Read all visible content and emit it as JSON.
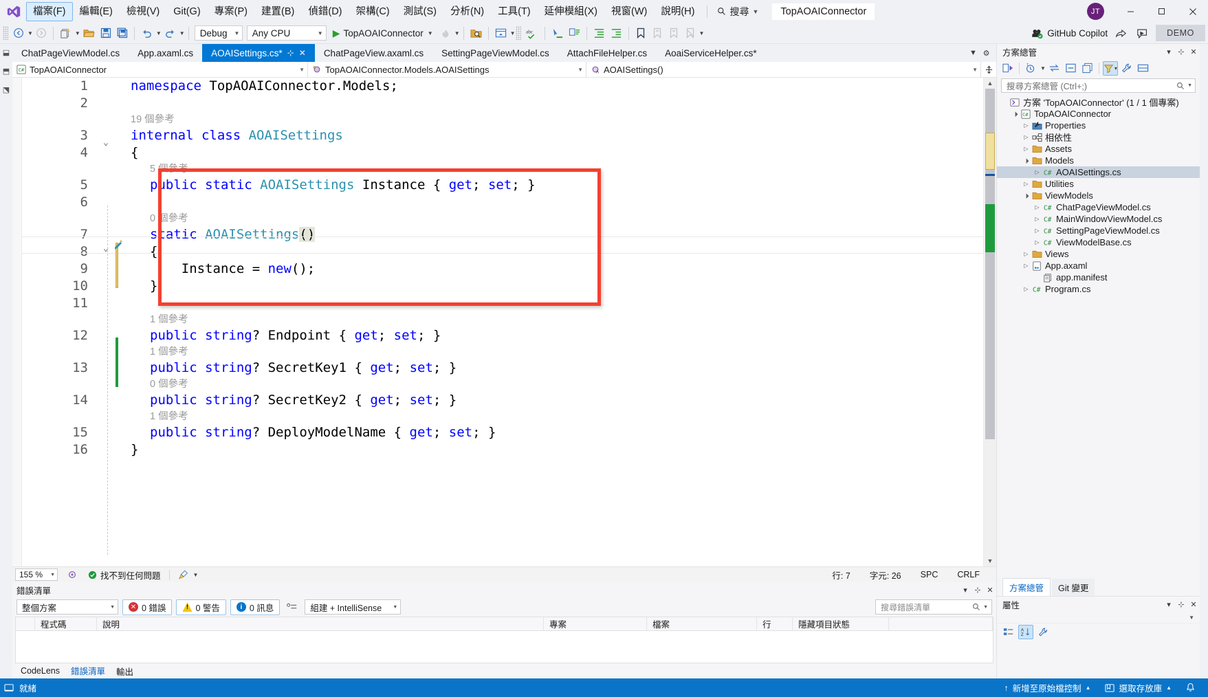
{
  "window": {
    "title": "TopAOAIConnector",
    "avatar_initials": "JT",
    "minimize": "–",
    "maximize": "▢",
    "close": "✕"
  },
  "menu": {
    "items": [
      {
        "label": "檔案(F)",
        "name": "file"
      },
      {
        "label": "編輯(E)",
        "name": "edit"
      },
      {
        "label": "檢視(V)",
        "name": "view"
      },
      {
        "label": "Git(G)",
        "name": "git"
      },
      {
        "label": "專案(P)",
        "name": "project"
      },
      {
        "label": "建置(B)",
        "name": "build"
      },
      {
        "label": "偵錯(D)",
        "name": "debug"
      },
      {
        "label": "架構(C)",
        "name": "architecture"
      },
      {
        "label": "測試(S)",
        "name": "test"
      },
      {
        "label": "分析(N)",
        "name": "analyze"
      },
      {
        "label": "工具(T)",
        "name": "tools"
      },
      {
        "label": "延伸模組(X)",
        "name": "extensions"
      },
      {
        "label": "視窗(W)",
        "name": "window"
      },
      {
        "label": "說明(H)",
        "name": "help"
      }
    ],
    "active_index": 0,
    "search_label": "搜尋"
  },
  "toolbar": {
    "configuration": "Debug",
    "platform": "Any CPU",
    "run_target": "TopAOAIConnector",
    "copilot_label": "GitHub Copilot",
    "demo_label": "DEMO"
  },
  "tabs": {
    "items": [
      {
        "label": "ChatPageViewModel.cs",
        "active": false
      },
      {
        "label": "App.axaml.cs",
        "active": false
      },
      {
        "label": "AOAISettings.cs*",
        "active": true
      },
      {
        "label": "ChatPageView.axaml.cs",
        "active": false
      },
      {
        "label": "SettingPageViewModel.cs",
        "active": false
      },
      {
        "label": "AttachFileHelper.cs",
        "active": false
      },
      {
        "label": "AoaiServiceHelper.cs*",
        "active": false
      }
    ]
  },
  "navbar": {
    "project": "TopAOAIConnector",
    "type": "TopAOAIConnector.Models.AOAISettings",
    "member": "AOAISettings()"
  },
  "editor": {
    "lines": [
      {
        "num": "1",
        "tokens": [
          {
            "t": "namespace ",
            "c": "kw"
          },
          {
            "t": "TopAOAIConnector.Models;",
            "c": "plain"
          }
        ],
        "indent": 0
      },
      {
        "num": "2",
        "tokens": [],
        "indent": 0
      },
      {
        "num": "3",
        "tokens": [
          {
            "t": "internal ",
            "c": "kw"
          },
          {
            "t": "class ",
            "c": "kw"
          },
          {
            "t": "AOAISettings",
            "c": "typ"
          }
        ],
        "indent": 0,
        "codelens": "19 個參考",
        "fold": true
      },
      {
        "num": "4",
        "tokens": [
          {
            "t": "{",
            "c": "plain"
          }
        ],
        "indent": 0
      },
      {
        "num": "5",
        "tokens": [
          {
            "t": "public ",
            "c": "kw"
          },
          {
            "t": "static ",
            "c": "kw"
          },
          {
            "t": "AOAISettings ",
            "c": "typ"
          },
          {
            "t": "Instance ",
            "c": "plain"
          },
          {
            "t": "{ ",
            "c": "plain"
          },
          {
            "t": "get",
            "c": "kw"
          },
          {
            "t": "; ",
            "c": "plain"
          },
          {
            "t": "set",
            "c": "kw"
          },
          {
            "t": "; }",
            "c": "plain"
          }
        ],
        "indent": 1,
        "codelens": "5 個參考"
      },
      {
        "num": "6",
        "tokens": [],
        "indent": 1
      },
      {
        "num": "7",
        "tokens": [
          {
            "t": "static ",
            "c": "kw"
          },
          {
            "t": "AOAISettings",
            "c": "typ"
          },
          {
            "t": "()",
            "c": "brace"
          }
        ],
        "indent": 1,
        "codelens": "0 個參考",
        "fold": true,
        "current": true
      },
      {
        "num": "8",
        "tokens": [
          {
            "t": "{",
            "c": "plain"
          }
        ],
        "indent": 1
      },
      {
        "num": "9",
        "tokens": [
          {
            "t": "    Instance = ",
            "c": "plain"
          },
          {
            "t": "new",
            "c": "kw"
          },
          {
            "t": "();",
            "c": "plain"
          }
        ],
        "indent": 1
      },
      {
        "num": "10",
        "tokens": [
          {
            "t": "}",
            "c": "plain"
          }
        ],
        "indent": 1
      },
      {
        "num": "11",
        "tokens": [],
        "indent": 1
      },
      {
        "num": "12",
        "tokens": [
          {
            "t": "public ",
            "c": "kw"
          },
          {
            "t": "string",
            "c": "kw"
          },
          {
            "t": "? ",
            "c": "plain"
          },
          {
            "t": "Endpoint ",
            "c": "plain"
          },
          {
            "t": "{ ",
            "c": "plain"
          },
          {
            "t": "get",
            "c": "kw"
          },
          {
            "t": "; ",
            "c": "plain"
          },
          {
            "t": "set",
            "c": "kw"
          },
          {
            "t": "; }",
            "c": "plain"
          }
        ],
        "indent": 1,
        "codelens": "1 個參考"
      },
      {
        "num": "13",
        "tokens": [
          {
            "t": "public ",
            "c": "kw"
          },
          {
            "t": "string",
            "c": "kw"
          },
          {
            "t": "? ",
            "c": "plain"
          },
          {
            "t": "SecretKey1 ",
            "c": "plain"
          },
          {
            "t": "{ ",
            "c": "plain"
          },
          {
            "t": "get",
            "c": "kw"
          },
          {
            "t": "; ",
            "c": "plain"
          },
          {
            "t": "set",
            "c": "kw"
          },
          {
            "t": "; }",
            "c": "plain"
          }
        ],
        "indent": 1,
        "codelens": "1 個參考"
      },
      {
        "num": "14",
        "tokens": [
          {
            "t": "public ",
            "c": "kw"
          },
          {
            "t": "string",
            "c": "kw"
          },
          {
            "t": "? ",
            "c": "plain"
          },
          {
            "t": "SecretKey2 ",
            "c": "plain"
          },
          {
            "t": "{ ",
            "c": "plain"
          },
          {
            "t": "get",
            "c": "kw"
          },
          {
            "t": "; ",
            "c": "plain"
          },
          {
            "t": "set",
            "c": "kw"
          },
          {
            "t": "; }",
            "c": "plain"
          }
        ],
        "indent": 1,
        "codelens": "0 個參考"
      },
      {
        "num": "15",
        "tokens": [
          {
            "t": "public ",
            "c": "kw"
          },
          {
            "t": "string",
            "c": "kw"
          },
          {
            "t": "? ",
            "c": "plain"
          },
          {
            "t": "DeployModelName ",
            "c": "plain"
          },
          {
            "t": "{ ",
            "c": "plain"
          },
          {
            "t": "get",
            "c": "kw"
          },
          {
            "t": "; ",
            "c": "plain"
          },
          {
            "t": "set",
            "c": "kw"
          },
          {
            "t": "; }",
            "c": "plain"
          }
        ],
        "indent": 1,
        "codelens": "1 個參考"
      },
      {
        "num": "16",
        "tokens": [
          {
            "t": "}",
            "c": "plain"
          }
        ],
        "indent": 0
      }
    ],
    "annotation_color": "#f4402f"
  },
  "editor_status": {
    "zoom": "155 %",
    "issues": "找不到任何問題",
    "line_label": "行: 7",
    "char_label": "字元: 26",
    "spaces": "SPC",
    "line_ending": "CRLF"
  },
  "error_panel": {
    "title": "錯誤清單",
    "scope": "整個方案",
    "errors": "0 錯誤",
    "warnings": "0 警告",
    "messages": "0 訊息",
    "build_filter": "組建 + IntelliSense",
    "search_placeholder": "搜尋錯誤清單",
    "columns": [
      "",
      "程式碼",
      "說明",
      "專案",
      "檔案",
      "行",
      "隱藏項目狀態"
    ],
    "rows": [],
    "tabs": [
      {
        "label": "CodeLens",
        "active": false
      },
      {
        "label": "錯誤清單",
        "active": true
      },
      {
        "label": "輸出",
        "active": false
      }
    ]
  },
  "solution_explorer": {
    "title": "方案總管",
    "search_placeholder": "搜尋方案總管 (Ctrl+;)",
    "tree": [
      {
        "label": "方案 'TopAOAIConnector' (1 / 1 個專案)",
        "depth": 0,
        "arrow": "",
        "icon": "solution",
        "selected": false
      },
      {
        "label": "TopAOAIConnector",
        "depth": 1,
        "arrow": "▲",
        "icon": "csproj",
        "selected": false
      },
      {
        "label": "Properties",
        "depth": 2,
        "arrow": "▶",
        "icon": "properties",
        "selected": false
      },
      {
        "label": "相依性",
        "depth": 2,
        "arrow": "▶",
        "icon": "deps",
        "selected": false
      },
      {
        "label": "Assets",
        "depth": 2,
        "arrow": "▶",
        "icon": "folder",
        "selected": false
      },
      {
        "label": "Models",
        "depth": 2,
        "arrow": "▲",
        "icon": "folder",
        "selected": false
      },
      {
        "label": "AOAISettings.cs",
        "depth": 3,
        "arrow": "▶",
        "icon": "cs",
        "selected": true
      },
      {
        "label": "Utilities",
        "depth": 2,
        "arrow": "▶",
        "icon": "folder",
        "selected": false
      },
      {
        "label": "ViewModels",
        "depth": 2,
        "arrow": "▲",
        "icon": "folder",
        "selected": false
      },
      {
        "label": "ChatPageViewModel.cs",
        "depth": 3,
        "arrow": "▶",
        "icon": "cs",
        "selected": false
      },
      {
        "label": "MainWindowViewModel.cs",
        "depth": 3,
        "arrow": "▶",
        "icon": "cs",
        "selected": false
      },
      {
        "label": "SettingPageViewModel.cs",
        "depth": 3,
        "arrow": "▶",
        "icon": "cs",
        "selected": false
      },
      {
        "label": "ViewModelBase.cs",
        "depth": 3,
        "arrow": "▶",
        "icon": "cs",
        "selected": false
      },
      {
        "label": "Views",
        "depth": 2,
        "arrow": "▶",
        "icon": "folder",
        "selected": false
      },
      {
        "label": "App.axaml",
        "depth": 2,
        "arrow": "▶",
        "icon": "axaml",
        "selected": false
      },
      {
        "label": "app.manifest",
        "depth": 3,
        "arrow": "",
        "icon": "manifest",
        "selected": false
      },
      {
        "label": "Program.cs",
        "depth": 2,
        "arrow": "▶",
        "icon": "cs",
        "selected": false
      }
    ],
    "dock_tabs": [
      {
        "label": "方案總管",
        "active": true
      },
      {
        "label": "Git 變更",
        "active": false
      }
    ]
  },
  "properties_panel": {
    "title": "屬性"
  },
  "statusbar": {
    "ready": "就緒",
    "source_control": "新增至原始檔控制",
    "repo": "選取存放庫",
    "accent": "#0a74c8"
  }
}
